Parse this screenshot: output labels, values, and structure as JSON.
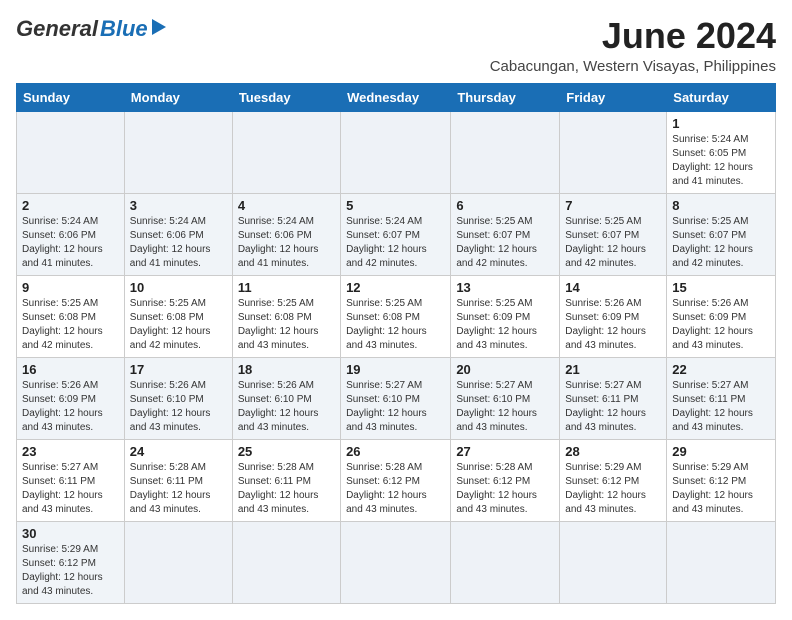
{
  "header": {
    "logo_general": "General",
    "logo_blue": "Blue",
    "month_title": "June 2024",
    "location": "Cabacungan, Western Visayas, Philippines"
  },
  "days_of_week": [
    "Sunday",
    "Monday",
    "Tuesday",
    "Wednesday",
    "Thursday",
    "Friday",
    "Saturday"
  ],
  "weeks": [
    {
      "days": [
        {
          "num": "",
          "sunrise": "",
          "sunset": "",
          "daylight": ""
        },
        {
          "num": "",
          "sunrise": "",
          "sunset": "",
          "daylight": ""
        },
        {
          "num": "",
          "sunrise": "",
          "sunset": "",
          "daylight": ""
        },
        {
          "num": "",
          "sunrise": "",
          "sunset": "",
          "daylight": ""
        },
        {
          "num": "",
          "sunrise": "",
          "sunset": "",
          "daylight": ""
        },
        {
          "num": "",
          "sunrise": "",
          "sunset": "",
          "daylight": ""
        },
        {
          "num": "1",
          "sunrise": "Sunrise: 5:24 AM",
          "sunset": "Sunset: 6:05 PM",
          "daylight": "Daylight: 12 hours and 41 minutes."
        }
      ]
    },
    {
      "days": [
        {
          "num": "2",
          "sunrise": "Sunrise: 5:24 AM",
          "sunset": "Sunset: 6:06 PM",
          "daylight": "Daylight: 12 hours and 41 minutes."
        },
        {
          "num": "3",
          "sunrise": "Sunrise: 5:24 AM",
          "sunset": "Sunset: 6:06 PM",
          "daylight": "Daylight: 12 hours and 41 minutes."
        },
        {
          "num": "4",
          "sunrise": "Sunrise: 5:24 AM",
          "sunset": "Sunset: 6:06 PM",
          "daylight": "Daylight: 12 hours and 41 minutes."
        },
        {
          "num": "5",
          "sunrise": "Sunrise: 5:24 AM",
          "sunset": "Sunset: 6:07 PM",
          "daylight": "Daylight: 12 hours and 42 minutes."
        },
        {
          "num": "6",
          "sunrise": "Sunrise: 5:25 AM",
          "sunset": "Sunset: 6:07 PM",
          "daylight": "Daylight: 12 hours and 42 minutes."
        },
        {
          "num": "7",
          "sunrise": "Sunrise: 5:25 AM",
          "sunset": "Sunset: 6:07 PM",
          "daylight": "Daylight: 12 hours and 42 minutes."
        },
        {
          "num": "8",
          "sunrise": "Sunrise: 5:25 AM",
          "sunset": "Sunset: 6:07 PM",
          "daylight": "Daylight: 12 hours and 42 minutes."
        }
      ]
    },
    {
      "days": [
        {
          "num": "9",
          "sunrise": "Sunrise: 5:25 AM",
          "sunset": "Sunset: 6:08 PM",
          "daylight": "Daylight: 12 hours and 42 minutes."
        },
        {
          "num": "10",
          "sunrise": "Sunrise: 5:25 AM",
          "sunset": "Sunset: 6:08 PM",
          "daylight": "Daylight: 12 hours and 42 minutes."
        },
        {
          "num": "11",
          "sunrise": "Sunrise: 5:25 AM",
          "sunset": "Sunset: 6:08 PM",
          "daylight": "Daylight: 12 hours and 43 minutes."
        },
        {
          "num": "12",
          "sunrise": "Sunrise: 5:25 AM",
          "sunset": "Sunset: 6:08 PM",
          "daylight": "Daylight: 12 hours and 43 minutes."
        },
        {
          "num": "13",
          "sunrise": "Sunrise: 5:25 AM",
          "sunset": "Sunset: 6:09 PM",
          "daylight": "Daylight: 12 hours and 43 minutes."
        },
        {
          "num": "14",
          "sunrise": "Sunrise: 5:26 AM",
          "sunset": "Sunset: 6:09 PM",
          "daylight": "Daylight: 12 hours and 43 minutes."
        },
        {
          "num": "15",
          "sunrise": "Sunrise: 5:26 AM",
          "sunset": "Sunset: 6:09 PM",
          "daylight": "Daylight: 12 hours and 43 minutes."
        }
      ]
    },
    {
      "days": [
        {
          "num": "16",
          "sunrise": "Sunrise: 5:26 AM",
          "sunset": "Sunset: 6:09 PM",
          "daylight": "Daylight: 12 hours and 43 minutes."
        },
        {
          "num": "17",
          "sunrise": "Sunrise: 5:26 AM",
          "sunset": "Sunset: 6:10 PM",
          "daylight": "Daylight: 12 hours and 43 minutes."
        },
        {
          "num": "18",
          "sunrise": "Sunrise: 5:26 AM",
          "sunset": "Sunset: 6:10 PM",
          "daylight": "Daylight: 12 hours and 43 minutes."
        },
        {
          "num": "19",
          "sunrise": "Sunrise: 5:27 AM",
          "sunset": "Sunset: 6:10 PM",
          "daylight": "Daylight: 12 hours and 43 minutes."
        },
        {
          "num": "20",
          "sunrise": "Sunrise: 5:27 AM",
          "sunset": "Sunset: 6:10 PM",
          "daylight": "Daylight: 12 hours and 43 minutes."
        },
        {
          "num": "21",
          "sunrise": "Sunrise: 5:27 AM",
          "sunset": "Sunset: 6:11 PM",
          "daylight": "Daylight: 12 hours and 43 minutes."
        },
        {
          "num": "22",
          "sunrise": "Sunrise: 5:27 AM",
          "sunset": "Sunset: 6:11 PM",
          "daylight": "Daylight: 12 hours and 43 minutes."
        }
      ]
    },
    {
      "days": [
        {
          "num": "23",
          "sunrise": "Sunrise: 5:27 AM",
          "sunset": "Sunset: 6:11 PM",
          "daylight": "Daylight: 12 hours and 43 minutes."
        },
        {
          "num": "24",
          "sunrise": "Sunrise: 5:28 AM",
          "sunset": "Sunset: 6:11 PM",
          "daylight": "Daylight: 12 hours and 43 minutes."
        },
        {
          "num": "25",
          "sunrise": "Sunrise: 5:28 AM",
          "sunset": "Sunset: 6:11 PM",
          "daylight": "Daylight: 12 hours and 43 minutes."
        },
        {
          "num": "26",
          "sunrise": "Sunrise: 5:28 AM",
          "sunset": "Sunset: 6:12 PM",
          "daylight": "Daylight: 12 hours and 43 minutes."
        },
        {
          "num": "27",
          "sunrise": "Sunrise: 5:28 AM",
          "sunset": "Sunset: 6:12 PM",
          "daylight": "Daylight: 12 hours and 43 minutes."
        },
        {
          "num": "28",
          "sunrise": "Sunrise: 5:29 AM",
          "sunset": "Sunset: 6:12 PM",
          "daylight": "Daylight: 12 hours and 43 minutes."
        },
        {
          "num": "29",
          "sunrise": "Sunrise: 5:29 AM",
          "sunset": "Sunset: 6:12 PM",
          "daylight": "Daylight: 12 hours and 43 minutes."
        }
      ]
    },
    {
      "days": [
        {
          "num": "30",
          "sunrise": "Sunrise: 5:29 AM",
          "sunset": "Sunset: 6:12 PM",
          "daylight": "Daylight: 12 hours and 43 minutes."
        },
        {
          "num": "",
          "sunrise": "",
          "sunset": "",
          "daylight": ""
        },
        {
          "num": "",
          "sunrise": "",
          "sunset": "",
          "daylight": ""
        },
        {
          "num": "",
          "sunrise": "",
          "sunset": "",
          "daylight": ""
        },
        {
          "num": "",
          "sunrise": "",
          "sunset": "",
          "daylight": ""
        },
        {
          "num": "",
          "sunrise": "",
          "sunset": "",
          "daylight": ""
        },
        {
          "num": "",
          "sunrise": "",
          "sunset": "",
          "daylight": ""
        }
      ]
    }
  ],
  "row_classes": [
    "row-1",
    "row-2",
    "row-3",
    "row-4",
    "row-5",
    "row-6"
  ]
}
